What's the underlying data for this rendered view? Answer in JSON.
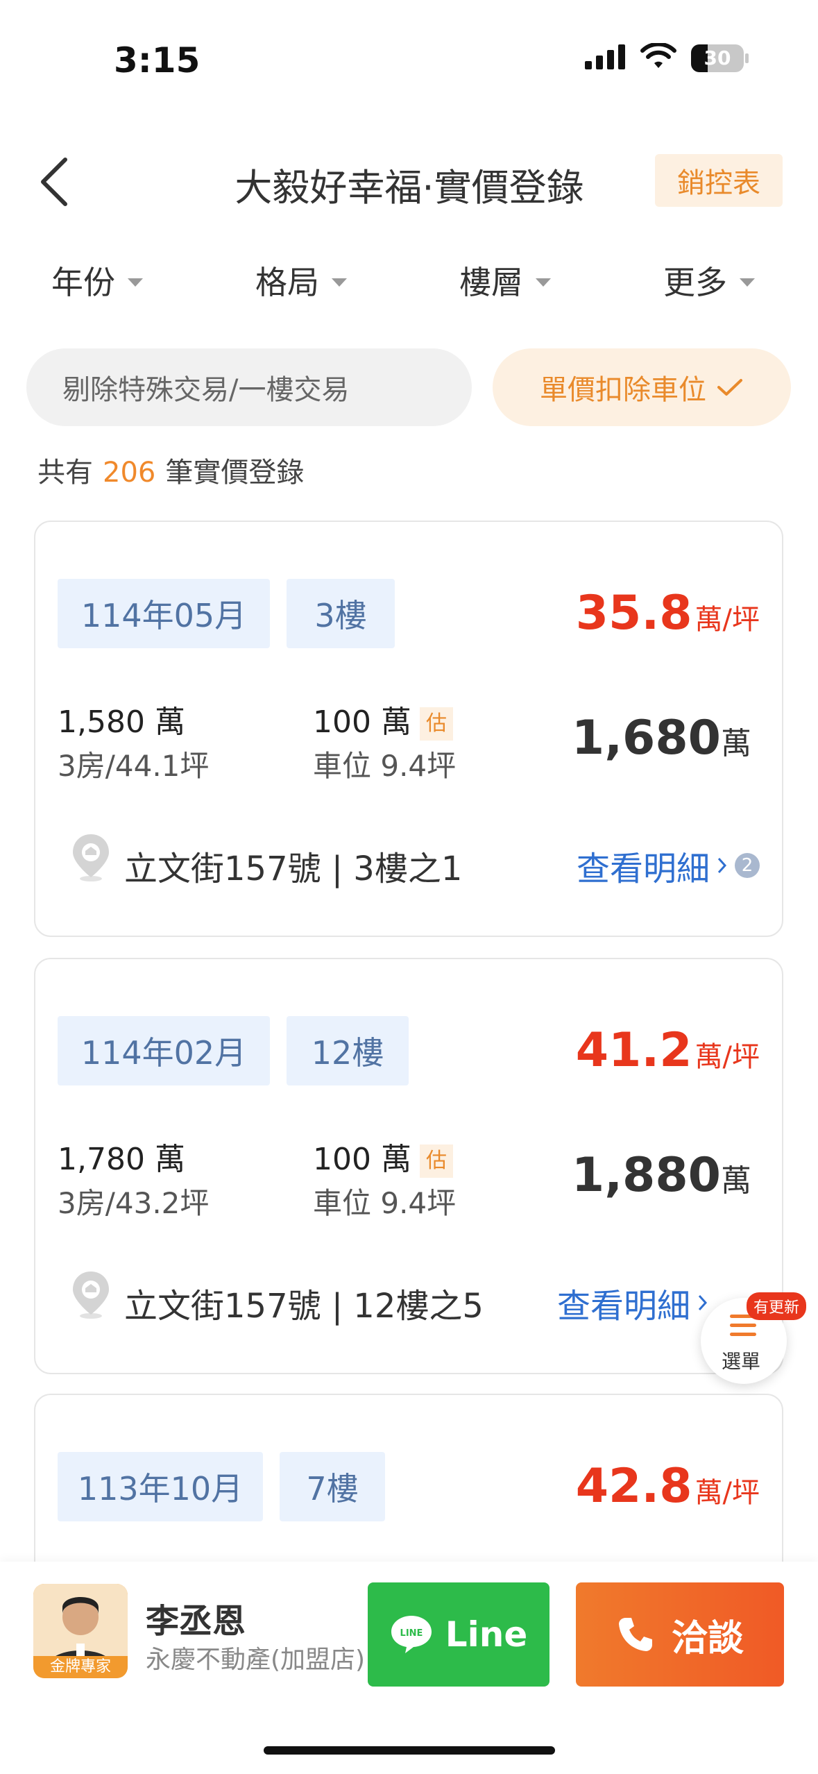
{
  "status": {
    "time": "3:15",
    "battery": "30"
  },
  "header": {
    "title": "大毅好幸福·實價登錄",
    "sales_button": "銷控表"
  },
  "filters": [
    "年份",
    "格局",
    "樓層",
    "更多"
  ],
  "chips": {
    "exclude": "剔除特殊交易/一樓交易",
    "unit_price": "單價扣除車位"
  },
  "summary": {
    "prefix": "共有",
    "count": "206",
    "suffix": "筆實價登錄"
  },
  "listings": [
    {
      "date": "114年05月",
      "floor": "3樓",
      "unit_price": "35.8",
      "unit_suffix": "萬/坪",
      "house_price": "1,580 萬",
      "layout": "3房/44.1坪",
      "parking_price": "100 萬",
      "est_label": "估",
      "parking_area": "車位 9.4坪",
      "total": "1,680",
      "total_suffix": "萬",
      "address": "立文街157號 | 3樓之1",
      "detail": "查看明細",
      "detail_count": "2"
    },
    {
      "date": "114年02月",
      "floor": "12樓",
      "unit_price": "41.2",
      "unit_suffix": "萬/坪",
      "house_price": "1,780 萬",
      "layout": "3房/43.2坪",
      "parking_price": "100 萬",
      "est_label": "估",
      "parking_area": "車位 9.4坪",
      "total": "1,880",
      "total_suffix": "萬",
      "address": "立文街157號 | 12樓之5",
      "detail": "查看明細"
    },
    {
      "date": "113年10月",
      "floor": "7樓",
      "unit_price": "42.8",
      "unit_suffix": "萬/坪"
    }
  ],
  "menu_fab": {
    "label": "選單",
    "badge": "有更新"
  },
  "agent": {
    "name": "李丞恩",
    "company": "永慶不動產(加盟店)",
    "badge": "金牌專家"
  },
  "actions": {
    "line": "Line",
    "call": "洽談"
  },
  "colors": {
    "accent_orange": "#f0892b",
    "price_red": "#e8361c",
    "link_blue": "#2f6fd0",
    "line_green": "#2dbb4a"
  }
}
